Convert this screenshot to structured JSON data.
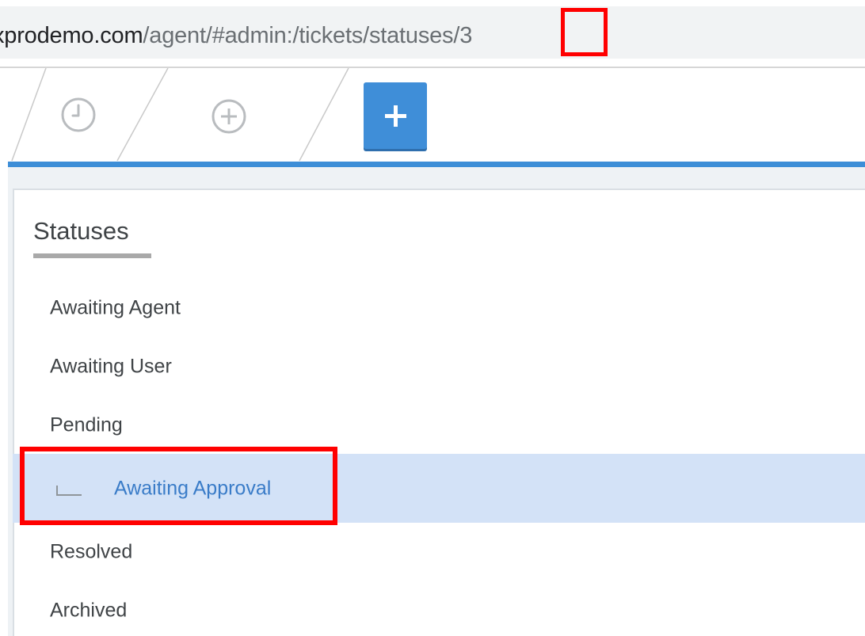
{
  "address_bar": {
    "host": "xprodemo.com",
    "path": "/agent/#admin:/tickets/statuses/3"
  },
  "toolbar": {
    "tabs": [
      {
        "icon": "clock-icon"
      },
      {
        "icon": "plus-circle-icon"
      }
    ],
    "add_button_icon": "plus-icon",
    "accent_color": "#3d8ed7"
  },
  "panel": {
    "title": "Statuses",
    "items": [
      {
        "label": "Awaiting Agent",
        "selected": false
      },
      {
        "label": "Awaiting User",
        "selected": false
      },
      {
        "label": "Pending",
        "selected": false
      },
      {
        "label": "Awaiting Approval",
        "selected": true,
        "child": true
      },
      {
        "label": "Resolved",
        "selected": false
      },
      {
        "label": "Archived",
        "selected": false
      }
    ]
  },
  "annotations": {
    "highlight_color": "#ff0000"
  }
}
